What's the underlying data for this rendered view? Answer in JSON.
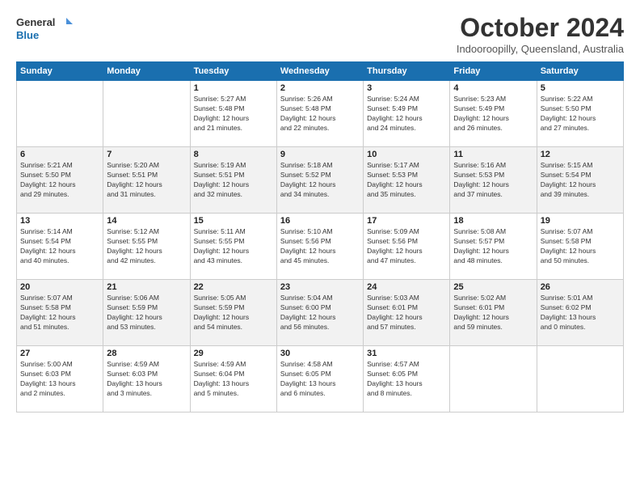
{
  "header": {
    "logo_line1": "General",
    "logo_line2": "Blue",
    "month": "October 2024",
    "location": "Indooroopilly, Queensland, Australia"
  },
  "days_of_week": [
    "Sunday",
    "Monday",
    "Tuesday",
    "Wednesday",
    "Thursday",
    "Friday",
    "Saturday"
  ],
  "weeks": [
    [
      {
        "day": "",
        "text": ""
      },
      {
        "day": "",
        "text": ""
      },
      {
        "day": "1",
        "text": "Sunrise: 5:27 AM\nSunset: 5:48 PM\nDaylight: 12 hours\nand 21 minutes."
      },
      {
        "day": "2",
        "text": "Sunrise: 5:26 AM\nSunset: 5:48 PM\nDaylight: 12 hours\nand 22 minutes."
      },
      {
        "day": "3",
        "text": "Sunrise: 5:24 AM\nSunset: 5:49 PM\nDaylight: 12 hours\nand 24 minutes."
      },
      {
        "day": "4",
        "text": "Sunrise: 5:23 AM\nSunset: 5:49 PM\nDaylight: 12 hours\nand 26 minutes."
      },
      {
        "day": "5",
        "text": "Sunrise: 5:22 AM\nSunset: 5:50 PM\nDaylight: 12 hours\nand 27 minutes."
      }
    ],
    [
      {
        "day": "6",
        "text": "Sunrise: 5:21 AM\nSunset: 5:50 PM\nDaylight: 12 hours\nand 29 minutes."
      },
      {
        "day": "7",
        "text": "Sunrise: 5:20 AM\nSunset: 5:51 PM\nDaylight: 12 hours\nand 31 minutes."
      },
      {
        "day": "8",
        "text": "Sunrise: 5:19 AM\nSunset: 5:51 PM\nDaylight: 12 hours\nand 32 minutes."
      },
      {
        "day": "9",
        "text": "Sunrise: 5:18 AM\nSunset: 5:52 PM\nDaylight: 12 hours\nand 34 minutes."
      },
      {
        "day": "10",
        "text": "Sunrise: 5:17 AM\nSunset: 5:53 PM\nDaylight: 12 hours\nand 35 minutes."
      },
      {
        "day": "11",
        "text": "Sunrise: 5:16 AM\nSunset: 5:53 PM\nDaylight: 12 hours\nand 37 minutes."
      },
      {
        "day": "12",
        "text": "Sunrise: 5:15 AM\nSunset: 5:54 PM\nDaylight: 12 hours\nand 39 minutes."
      }
    ],
    [
      {
        "day": "13",
        "text": "Sunrise: 5:14 AM\nSunset: 5:54 PM\nDaylight: 12 hours\nand 40 minutes."
      },
      {
        "day": "14",
        "text": "Sunrise: 5:12 AM\nSunset: 5:55 PM\nDaylight: 12 hours\nand 42 minutes."
      },
      {
        "day": "15",
        "text": "Sunrise: 5:11 AM\nSunset: 5:55 PM\nDaylight: 12 hours\nand 43 minutes."
      },
      {
        "day": "16",
        "text": "Sunrise: 5:10 AM\nSunset: 5:56 PM\nDaylight: 12 hours\nand 45 minutes."
      },
      {
        "day": "17",
        "text": "Sunrise: 5:09 AM\nSunset: 5:56 PM\nDaylight: 12 hours\nand 47 minutes."
      },
      {
        "day": "18",
        "text": "Sunrise: 5:08 AM\nSunset: 5:57 PM\nDaylight: 12 hours\nand 48 minutes."
      },
      {
        "day": "19",
        "text": "Sunrise: 5:07 AM\nSunset: 5:58 PM\nDaylight: 12 hours\nand 50 minutes."
      }
    ],
    [
      {
        "day": "20",
        "text": "Sunrise: 5:07 AM\nSunset: 5:58 PM\nDaylight: 12 hours\nand 51 minutes."
      },
      {
        "day": "21",
        "text": "Sunrise: 5:06 AM\nSunset: 5:59 PM\nDaylight: 12 hours\nand 53 minutes."
      },
      {
        "day": "22",
        "text": "Sunrise: 5:05 AM\nSunset: 5:59 PM\nDaylight: 12 hours\nand 54 minutes."
      },
      {
        "day": "23",
        "text": "Sunrise: 5:04 AM\nSunset: 6:00 PM\nDaylight: 12 hours\nand 56 minutes."
      },
      {
        "day": "24",
        "text": "Sunrise: 5:03 AM\nSunset: 6:01 PM\nDaylight: 12 hours\nand 57 minutes."
      },
      {
        "day": "25",
        "text": "Sunrise: 5:02 AM\nSunset: 6:01 PM\nDaylight: 12 hours\nand 59 minutes."
      },
      {
        "day": "26",
        "text": "Sunrise: 5:01 AM\nSunset: 6:02 PM\nDaylight: 13 hours\nand 0 minutes."
      }
    ],
    [
      {
        "day": "27",
        "text": "Sunrise: 5:00 AM\nSunset: 6:03 PM\nDaylight: 13 hours\nand 2 minutes."
      },
      {
        "day": "28",
        "text": "Sunrise: 4:59 AM\nSunset: 6:03 PM\nDaylight: 13 hours\nand 3 minutes."
      },
      {
        "day": "29",
        "text": "Sunrise: 4:59 AM\nSunset: 6:04 PM\nDaylight: 13 hours\nand 5 minutes."
      },
      {
        "day": "30",
        "text": "Sunrise: 4:58 AM\nSunset: 6:05 PM\nDaylight: 13 hours\nand 6 minutes."
      },
      {
        "day": "31",
        "text": "Sunrise: 4:57 AM\nSunset: 6:05 PM\nDaylight: 13 hours\nand 8 minutes."
      },
      {
        "day": "",
        "text": ""
      },
      {
        "day": "",
        "text": ""
      }
    ]
  ]
}
